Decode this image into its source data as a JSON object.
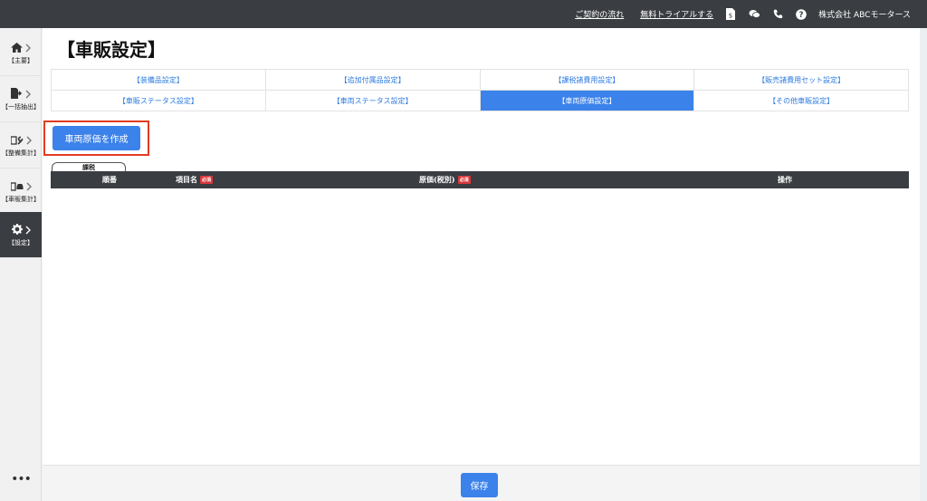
{
  "topbar": {
    "contract_flow": "ご契約の流れ",
    "free_trial": "無料トライアルする",
    "company": "株式会社 ABCモータース",
    "icons": [
      "document-yen-icon",
      "chat-icon",
      "phone-icon",
      "help-icon"
    ]
  },
  "sidebar": {
    "items": [
      {
        "label": "【主要】",
        "icon": "home-icon"
      },
      {
        "label": "【一括抽出】",
        "icon": "export-icon"
      },
      {
        "label": "【整備集計】",
        "icon": "wrench-icon"
      },
      {
        "label": "【車販集計】",
        "icon": "car-icon"
      },
      {
        "label": "【設定】",
        "icon": "gear-icon"
      }
    ],
    "more": "•••"
  },
  "page": {
    "title": "【車販設定】"
  },
  "tabs": [
    {
      "label": "【装備品設定】",
      "active": false
    },
    {
      "label": "【追加付属品設定】",
      "active": false
    },
    {
      "label": "【課税諸費用設定】",
      "active": false
    },
    {
      "label": "【販売諸費用セット設定】",
      "active": false
    },
    {
      "label": "【車販ステータス設定】",
      "active": false
    },
    {
      "label": "【車両ステータス設定】",
      "active": false
    },
    {
      "label": "【車両原価設定】",
      "active": true
    },
    {
      "label": "【その他車販設定】",
      "active": false
    }
  ],
  "create_button": "車両原価を作成",
  "tax_tab": "課税",
  "table": {
    "headers": {
      "order": "順番",
      "item_name": "項目名",
      "cost": "原価(税別)",
      "actions": "操作"
    },
    "required": "必須"
  },
  "footer": {
    "save": "保存"
  },
  "colors": {
    "accent": "#3b82ea",
    "dark": "#3a3d42",
    "highlight": "#e23b1f",
    "required": "#d9383a"
  }
}
